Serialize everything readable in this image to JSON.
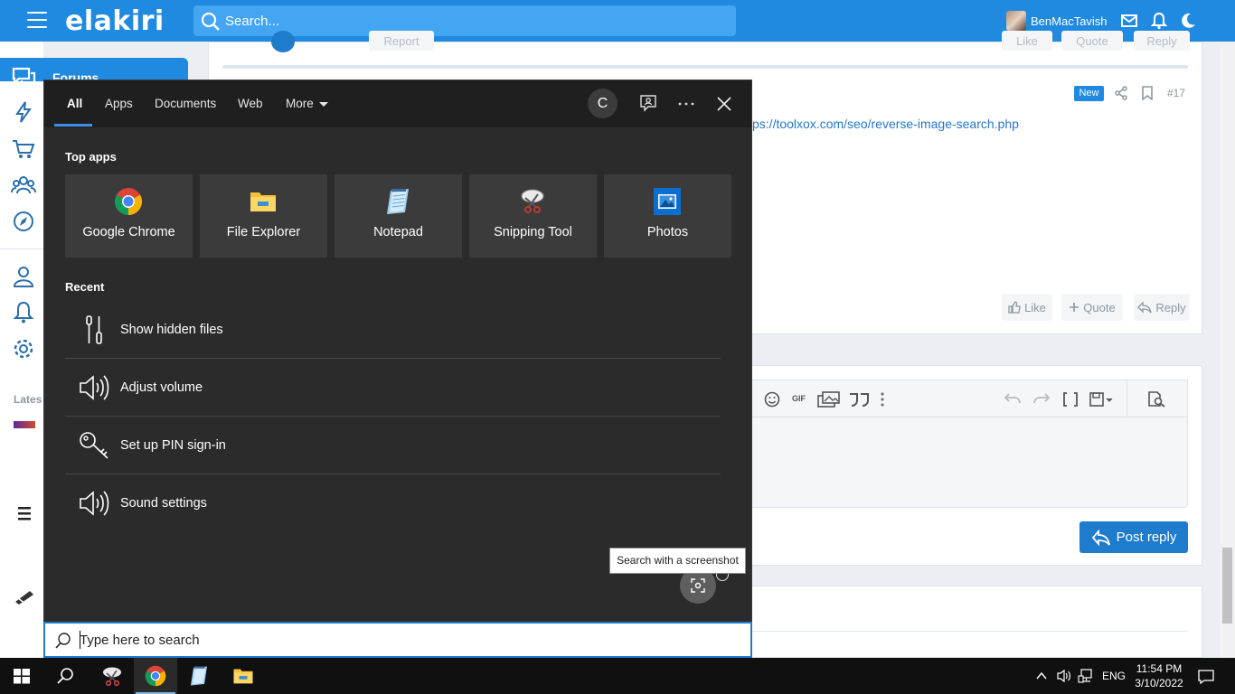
{
  "site": {
    "logo": "elakiri",
    "search_placeholder": "Search...",
    "username": "BenMacTavish",
    "forums_tab": "Forums",
    "latest_label": "Lates",
    "post_link": "ps://toolxox.com/seo/reverse-image-search.php",
    "new_badge": "New",
    "post_number": "#17",
    "like": "Like",
    "quote": "Quote",
    "reply": "Reply",
    "report": "Report",
    "post_reply": "Post reply",
    "gif_label": "GIF"
  },
  "search_panel": {
    "tabs": [
      "All",
      "Apps",
      "Documents",
      "Web",
      "More"
    ],
    "user_initial": "C",
    "top_apps_title": "Top apps",
    "top_apps": [
      {
        "label": "Google Chrome",
        "icon": "chrome-icon"
      },
      {
        "label": "File Explorer",
        "icon": "file-explorer-icon"
      },
      {
        "label": "Notepad",
        "icon": "notepad-icon"
      },
      {
        "label": "Snipping Tool",
        "icon": "snipping-tool-icon"
      },
      {
        "label": "Photos",
        "icon": "photos-icon"
      }
    ],
    "recent_title": "Recent",
    "recent": [
      {
        "label": "Show hidden files",
        "icon": "settings-sliders-icon"
      },
      {
        "label": "Adjust volume",
        "icon": "speaker-icon"
      },
      {
        "label": "Set up PIN sign-in",
        "icon": "key-icon"
      },
      {
        "label": "Sound settings",
        "icon": "speaker-icon"
      }
    ],
    "tooltip": "Search with a screenshot",
    "search_placeholder": "Type here to search"
  },
  "taskbar": {
    "language": "ENG",
    "time": "11:54 PM",
    "date": "3/10/2022"
  }
}
